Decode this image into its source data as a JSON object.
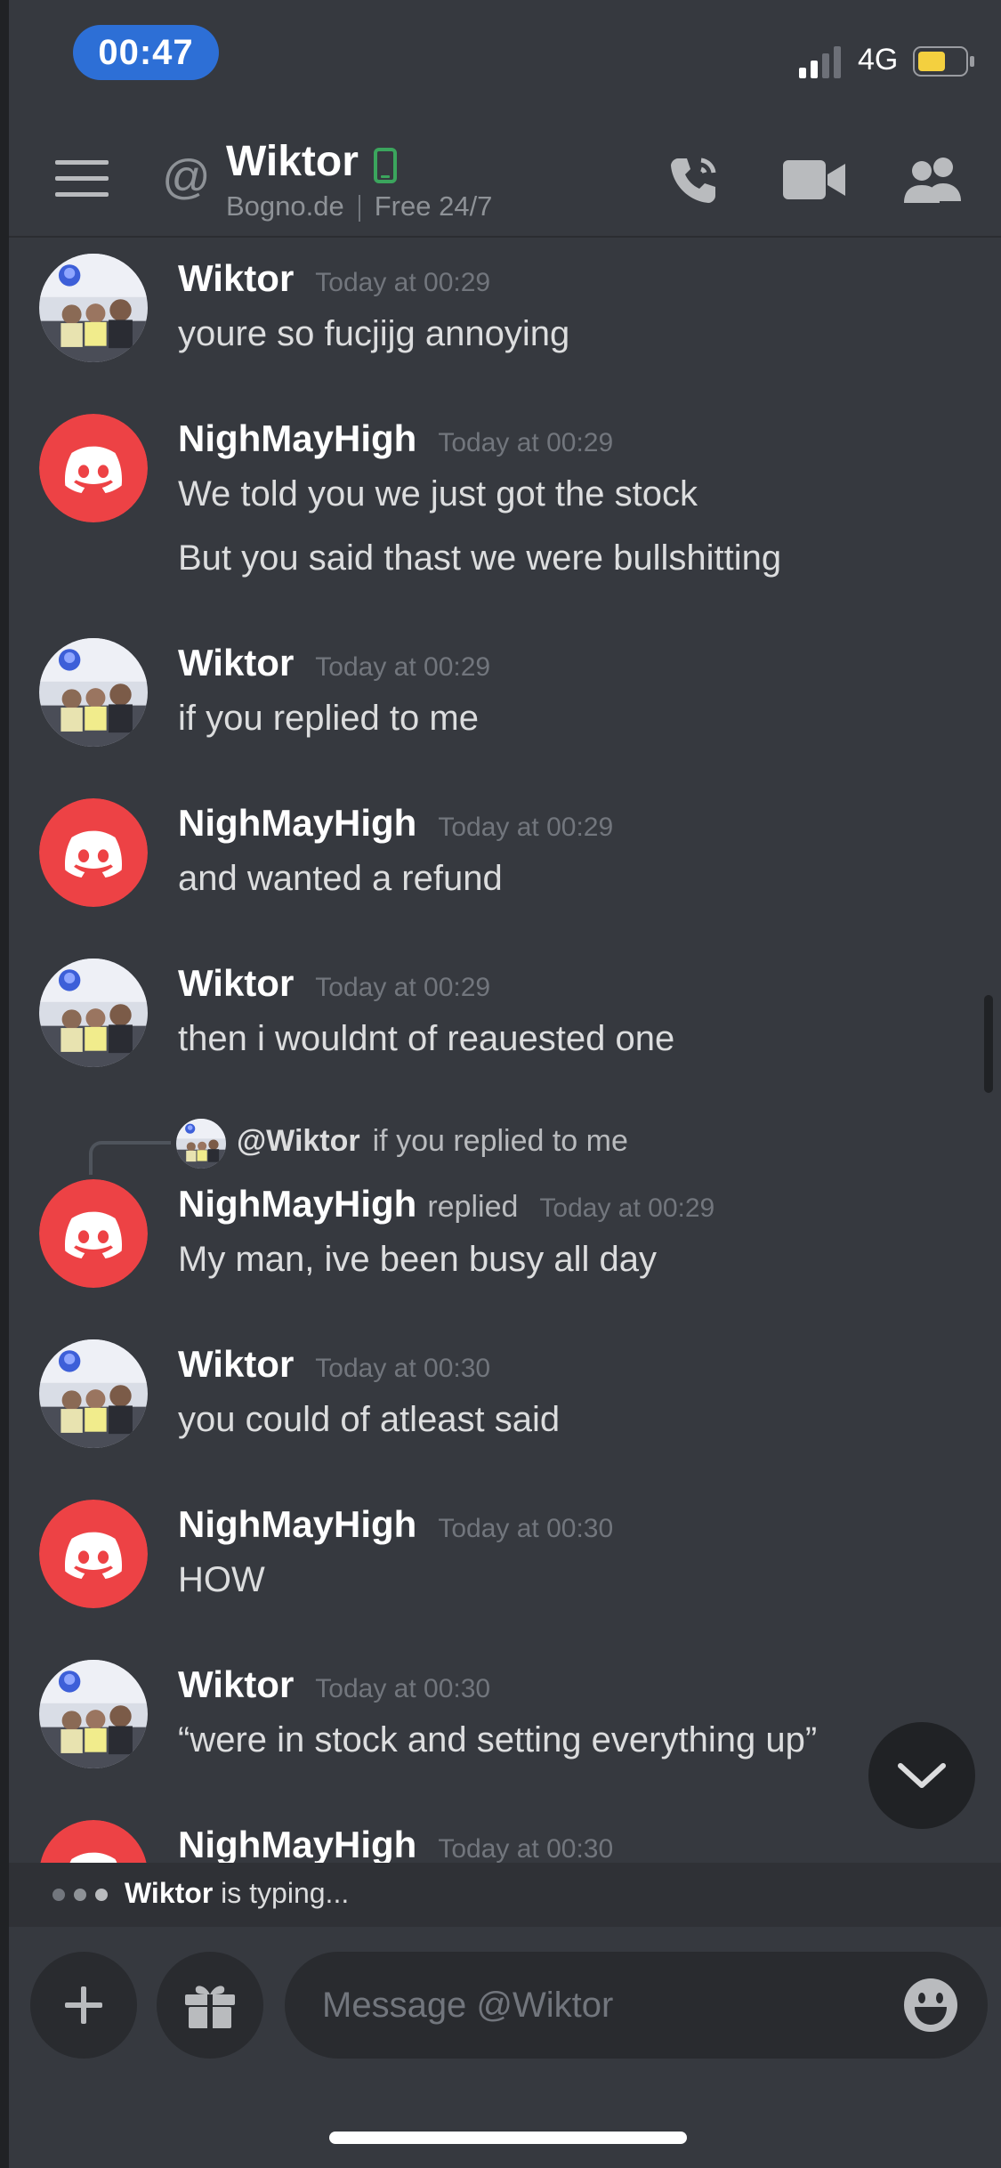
{
  "status_bar": {
    "time": "00:47",
    "network": "4G"
  },
  "header": {
    "name": "Wiktor",
    "status_text": "Bogno.de",
    "status_extra": "Free 24/7"
  },
  "messages": [
    {
      "author": "Wiktor",
      "time": "Today at 00:29",
      "lines": [
        "youre so fucjijg annoying"
      ]
    },
    {
      "author": "NighMayHigh",
      "time": "Today at 00:29",
      "lines": [
        "We told you we just got the stock",
        "But you said thast we were bullshitting"
      ]
    },
    {
      "author": "Wiktor",
      "time": "Today at 00:29",
      "lines": [
        "if you replied to me"
      ]
    },
    {
      "author": "NighMayHigh",
      "time": "Today at 00:29",
      "lines": [
        "and wanted a refund"
      ]
    },
    {
      "author": "Wiktor",
      "time": "Today at 00:29",
      "lines": [
        "then i wouldnt of reauested one"
      ]
    },
    {
      "author": "NighMayHigh",
      "replied_label": "replied",
      "reply_to": {
        "mention": "@Wiktor",
        "preview": "if you replied to me"
      },
      "time": "Today at 00:29",
      "lines": [
        "My man, ive been busy all day"
      ]
    },
    {
      "author": "Wiktor",
      "time": "Today at 00:30",
      "lines": [
        "you could of atleast said"
      ]
    },
    {
      "author": "NighMayHigh",
      "time": "Today at 00:30",
      "lines": [
        "HOW"
      ]
    },
    {
      "author": "Wiktor",
      "time": "Today at 00:30",
      "lines": [
        "“were in stock and setting everything up”"
      ]
    },
    {
      "author": "NighMayHigh",
      "time": "Today at 00:30",
      "lines": []
    }
  ],
  "typing": {
    "user": "Wiktor",
    "suffix": "is typing..."
  },
  "composer": {
    "placeholder": "Message @Wiktor"
  },
  "colors": {
    "background": "#36393f",
    "accent": "#2d6fd6",
    "discord_red": "#ed4245",
    "online_green": "#3ba55d",
    "battery": "#f4d03f"
  },
  "icons": [
    "signal-icon",
    "battery-icon",
    "menu-icon",
    "at-icon",
    "mobile-icon",
    "call-icon",
    "video-icon",
    "members-icon",
    "chevron-down-icon",
    "plus-icon",
    "gift-icon",
    "emoji-icon"
  ]
}
